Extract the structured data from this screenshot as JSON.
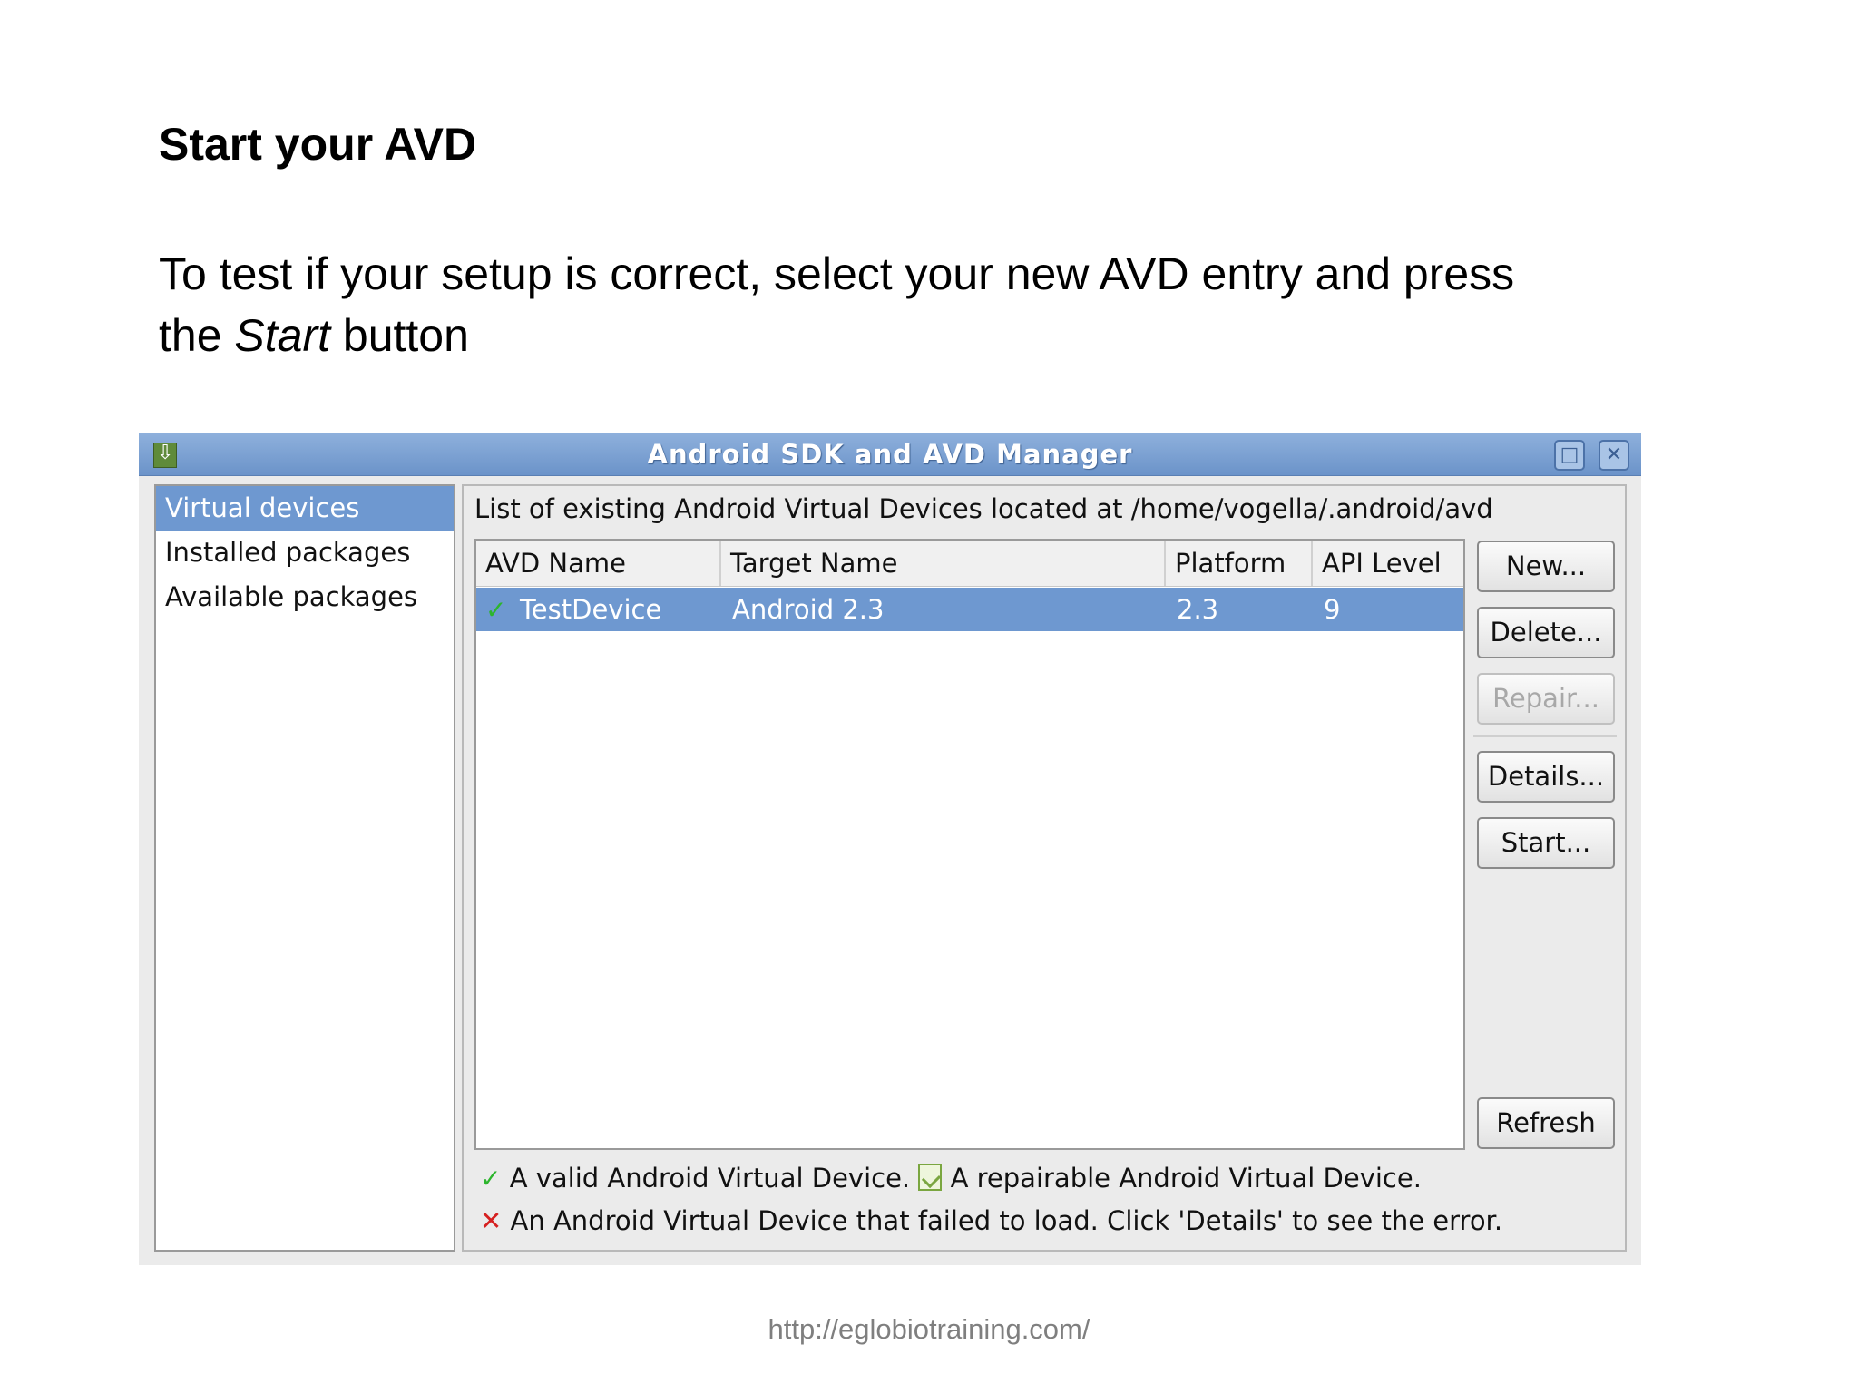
{
  "slide": {
    "title": "Start your AVD",
    "body_line1": "To test if your setup is correct, select your new AVD entry and press",
    "body_line2_before": "the ",
    "body_line2_em": "Start",
    "body_line2_after": " button",
    "footer_url": "http://eglobiotraining.com/"
  },
  "window": {
    "title": "Android SDK and AVD Manager",
    "maximize_icon": "maximize-icon",
    "close_icon": "close-icon"
  },
  "nav": {
    "items": [
      {
        "label": "Virtual devices",
        "selected": true
      },
      {
        "label": "Installed packages",
        "selected": false
      },
      {
        "label": "Available packages",
        "selected": false
      }
    ]
  },
  "main": {
    "caption": "List of existing Android Virtual Devices located at /home/vogella/.android/avd",
    "columns": [
      "AVD Name",
      "Target Name",
      "Platform",
      "API Level"
    ],
    "rows": [
      {
        "status_icon": "check-icon",
        "avd_name": "TestDevice",
        "target_name": "Android 2.3",
        "platform": "2.3",
        "api_level": "9"
      }
    ],
    "buttons": {
      "new": "New...",
      "delete": "Delete...",
      "repair": "Repair...",
      "details": "Details...",
      "start": "Start...",
      "refresh": "Refresh"
    },
    "legend": {
      "valid": "A valid Android Virtual Device.",
      "repairable": "A repairable Android Virtual Device.",
      "failed": "An Android Virtual Device that failed to load. Click 'Details' to see the error."
    }
  },
  "colors": {
    "selection": "#6e98d0",
    "titlebar": "#7da2d4",
    "valid_check": "#2db52d",
    "error_x": "#d62020"
  }
}
